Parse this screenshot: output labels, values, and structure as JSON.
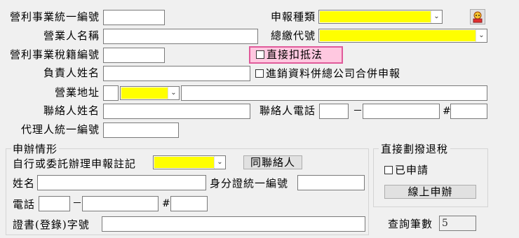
{
  "labels": {
    "uniform_number": "營利事業統一編號",
    "business_name": "營業人名稱",
    "tax_reg_number": "營利事業稅籍編號",
    "responsible_person": "負責人姓名",
    "business_address": "營業地址",
    "contact_name": "聯絡人姓名",
    "agent_number": "代理人統一編號",
    "report_type": "申報種類",
    "total_payment_code": "總繳代號",
    "contact_phone": "聯絡人電話",
    "phone_dash": "－",
    "phone_hash": "#"
  },
  "checkboxes": {
    "direct_deduction": "直接扣抵法",
    "hq_combined": "進銷資料併總公司合併申報"
  },
  "filing": {
    "group_title": "申辦情形",
    "self_or_delegate": "自行或委託辦理申報註記",
    "same_contact_button": "同聯絡人",
    "name": "姓名",
    "id_number": "身分證統一編號",
    "phone": "電話",
    "phone_dash": "－",
    "phone_hash": "#",
    "certificate": "證書(登錄)字號"
  },
  "refund": {
    "group_title": "直接劃撥退稅",
    "applied": "已申請",
    "online_button": "線上申辦"
  },
  "query": {
    "label": "查詢筆數",
    "value": "5"
  },
  "colors": {
    "highlight": "#ffff00",
    "direct_deduction_bg": "#ffc8e0",
    "direct_deduction_border": "#e05a9a"
  }
}
